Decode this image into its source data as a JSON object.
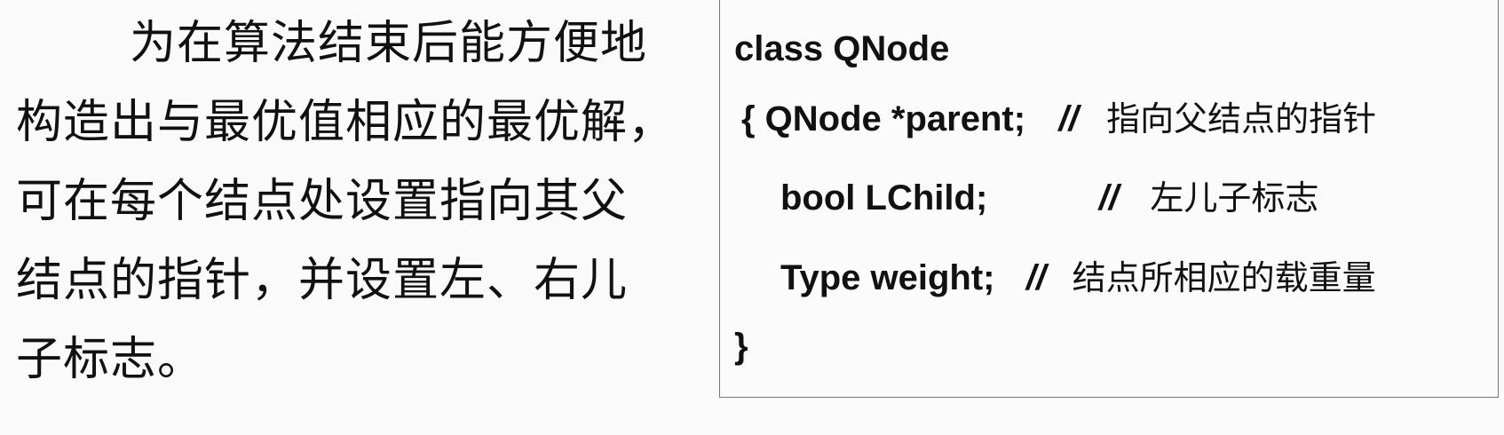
{
  "paragraph": {
    "lines": [
      "为在算法结束后能方便地",
      "构造出与最优值相应的最优解，",
      "可在每个结点处设置指向其父",
      "结点的指针，并设置左、右儿",
      "子标志。"
    ]
  },
  "code": {
    "line1": "class QNode",
    "line2_code": "{ QNode *parent;",
    "line2_slashes": "//",
    "line2_comment": "指向父结点的指针",
    "line3_code": "bool LChild;",
    "line3_slashes": "//",
    "line3_comment": "左儿子标志",
    "line4_code": "Type weight;",
    "line4_slashes": "//",
    "line4_comment": "结点所相应的载重量",
    "line5": "}"
  }
}
